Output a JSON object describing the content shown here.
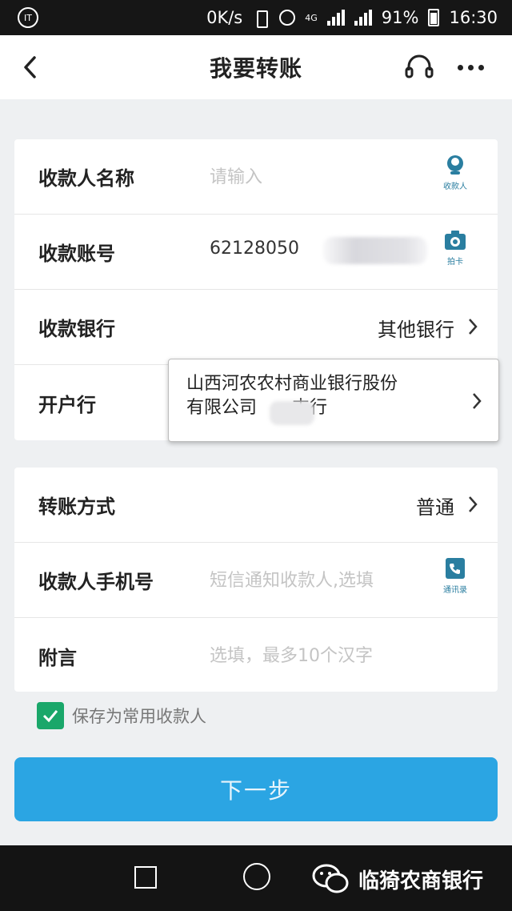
{
  "status_bar": {
    "network_speed": "0K/s",
    "network_type": "4G",
    "battery": "91%",
    "time": "16:30"
  },
  "nav": {
    "title": "我要转账"
  },
  "form": {
    "payee_name": {
      "label": "收款人名称",
      "placeholder": "请输入",
      "side_caption": "收款人"
    },
    "account_no": {
      "label": "收款账号",
      "value": "62128050",
      "side_caption": "拍卡"
    },
    "bank": {
      "label": "收款银行",
      "value": "其他银行"
    },
    "branch": {
      "label": "开户行",
      "line1": "山西河农农村商业银行股份",
      "line2": "有限公司　　支行"
    },
    "transfer_mode": {
      "label": "转账方式",
      "value": "普通"
    },
    "payee_phone": {
      "label": "收款人手机号",
      "placeholder": "短信通知收款人,选填",
      "side_caption": "通讯录"
    },
    "remark": {
      "label": "附言",
      "placeholder": "选填，最多10个汉字"
    }
  },
  "save_payee": {
    "label": "保存为常用收款人",
    "checked": true
  },
  "next_button": {
    "label": "下一步"
  },
  "watermark": {
    "text": "临猗农商银行"
  },
  "colors": {
    "primary_button": "#2ba5e3",
    "checkbox": "#1aa76a",
    "icon_teal": "#2a7ea0"
  }
}
